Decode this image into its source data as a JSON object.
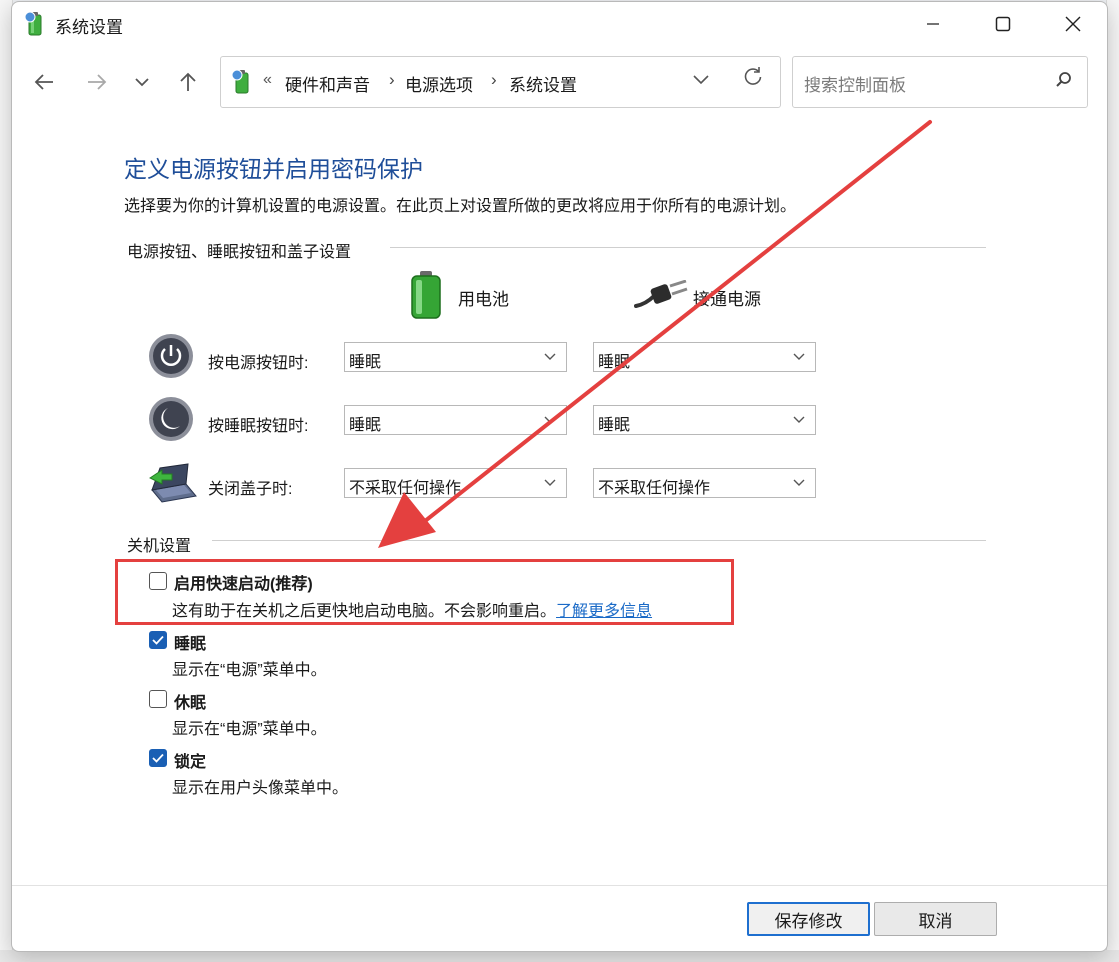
{
  "window": {
    "title": "系统设置"
  },
  "navigation": {
    "breadcrumb_prefix": "«",
    "breadcrumbs": [
      "硬件和声音",
      "电源选项",
      "系统设置"
    ],
    "search_placeholder": "搜索控制面板"
  },
  "page": {
    "title": "定义电源按钮并启用密码保护",
    "description": "选择要为你的计算机设置的电源设置。在此页上对设置所做的更改将应用于你所有的电源计划。"
  },
  "power_buttons": {
    "section_label": "电源按钮、睡眠按钮和盖子设置",
    "column_battery": "用电池",
    "column_plugged": "接通电源",
    "rows": [
      {
        "label": "按电源按钮时:",
        "battery": "睡眠",
        "plugged": "睡眠"
      },
      {
        "label": "按睡眠按钮时:",
        "battery": "睡眠",
        "plugged": "睡眠"
      },
      {
        "label": "关闭盖子时:",
        "battery": "不采取任何操作",
        "plugged": "不采取任何操作"
      }
    ]
  },
  "shutdown": {
    "section_label": "关机设置",
    "options": [
      {
        "title": "启用快速启动(推荐)",
        "checked": false,
        "desc": "这有助于在关机之后更快地启动电脑。不会影响重启。",
        "link": "了解更多信息"
      },
      {
        "title": "睡眠",
        "checked": true,
        "desc": "显示在“电源”菜单中。"
      },
      {
        "title": "休眠",
        "checked": false,
        "desc": "显示在“电源”菜单中。"
      },
      {
        "title": "锁定",
        "checked": true,
        "desc": "显示在用户头像菜单中。"
      }
    ]
  },
  "buttons": {
    "save": "保存修改",
    "cancel": "取消"
  },
  "annotation": {
    "highlight_color": "#e4403f"
  },
  "colors": {
    "title_blue": "#1f4e99",
    "link_blue": "#1a6ac7",
    "checkbox_blue": "#1a5fb4"
  }
}
